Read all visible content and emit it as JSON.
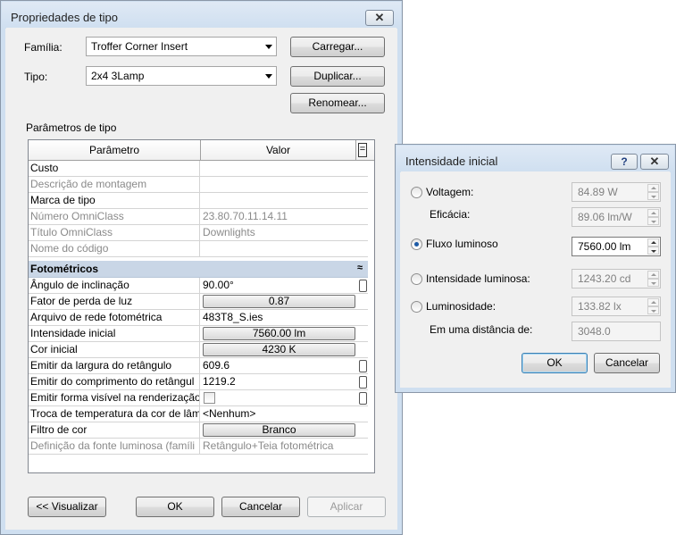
{
  "main_dialog": {
    "title": "Propriedades de tipo",
    "close_glyph": "✕",
    "family_label": "Família:",
    "family_value": "Troffer Corner Insert",
    "type_label": "Tipo:",
    "type_value": "2x4 3Lamp",
    "load_button": "Carregar...",
    "duplicate_button": "Duplicar...",
    "rename_button": "Renomear...",
    "type_params_label": "Parâmetros de tipo",
    "grid": {
      "col_param": "Parâmetro",
      "col_value": "Valor",
      "menu_glyph": "=",
      "group_title": "Fotométricos",
      "group_collapse_glyph": "≈",
      "rows_top": [
        {
          "name": "Custo",
          "value": ""
        },
        {
          "name": "Descrição de montagem",
          "value": ""
        },
        {
          "name": "Marca de tipo",
          "value": ""
        },
        {
          "name": "Número OmniClass",
          "value": "23.80.70.11.14.11"
        },
        {
          "name": "Título OmniClass",
          "value": "Downlights"
        },
        {
          "name": "Nome do código",
          "value": ""
        }
      ],
      "rows_photo": [
        {
          "name": "Ângulo de inclinação",
          "value": "90.00°"
        },
        {
          "name": "Fator de perda de luz",
          "value": "0.87"
        },
        {
          "name": "Arquivo de rede fotométrica",
          "value": "483T8_S.ies"
        },
        {
          "name": "Intensidade inicial",
          "value": "7560.00 lm"
        },
        {
          "name": "Cor inicial",
          "value": "4230 K"
        },
        {
          "name": "Emitir da largura do retângulo",
          "value": "609.6"
        },
        {
          "name": "Emitir do comprimento do retângul",
          "value": "1219.2"
        },
        {
          "name": "Emitir forma visível na renderização",
          "value": ""
        },
        {
          "name": "Troca de temperatura da cor de lâm",
          "value": "<Nenhum>"
        },
        {
          "name": "Filtro de cor",
          "value": "Branco"
        },
        {
          "name": "Definição da fonte luminosa (famíli",
          "value": "Retângulo+Teia fotométrica"
        }
      ]
    },
    "preview_button": "<< Visualizar",
    "ok_button": "OK",
    "cancel_button": "Cancelar",
    "apply_button": "Aplicar"
  },
  "sub_dialog": {
    "title": "Intensidade inicial",
    "help_glyph": "?",
    "close_glyph": "✕",
    "voltage_label": "Voltagem:",
    "voltage_value": "84.89 W",
    "efficacy_label": "Eficácia:",
    "efficacy_value": "89.06 lm/W",
    "flux_label": "Fluxo luminoso",
    "flux_value": "7560.00 lm",
    "intensity_label": "Intensidade luminosa:",
    "intensity_value": "1243.20 cd",
    "luminance_label": "Luminosidade:",
    "luminance_value": "133.82 lx",
    "distance_label": "Em uma distância de:",
    "distance_value": "3048.0",
    "ok_button": "OK",
    "cancel_button": "Cancelar"
  }
}
